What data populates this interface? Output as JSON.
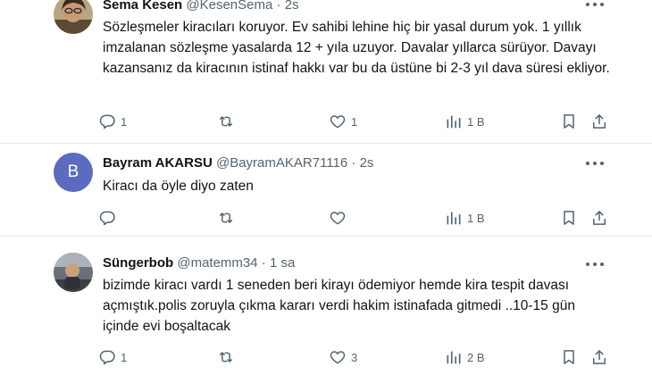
{
  "tweets": [
    {
      "name": "Sema Kesen",
      "handle": "@KesenSema",
      "sep": "·",
      "time": "2s",
      "text": "Sözleşmeler kiracıları koruyor. Ev sahibi lehine hiç bir yasal durum yok. 1 yıllık imzalanan sözleşme yasalarda 12 + yıla uzuyor. Davalar yıllarca sürüyor. Davayı kazansanız da kiracının istinaf hakkı var bu da üstüne bi 2-3 yıl dava süresi ekliyor.",
      "replies": "1",
      "reposts": "",
      "likes": "1",
      "views": "1 B"
    },
    {
      "name": "Bayram AKARSU",
      "handle": "@BayramAKAR71116",
      "sep": "·",
      "time": "2s",
      "avatar_letter": "B",
      "text": "Kiracı da öyle diyo  zaten",
      "replies": "",
      "reposts": "",
      "likes": "",
      "views": "1 B"
    },
    {
      "name": "Süngerbob",
      "handle": "@matemm34",
      "sep": "·",
      "time": "1 sa",
      "text": "bizimde kiracı vardı 1 seneden beri kirayı ödemiyor hemde kira tespit davası açmıştık.polis zoruyla çıkma kararı verdi hakim istinafada gitmedi ..10-15 gün içinde evi boşaltacak",
      "replies": "1",
      "reposts": "",
      "likes": "3",
      "views": "2 B"
    }
  ],
  "icons": {
    "reply": "reply-icon",
    "repost": "repost-icon",
    "like": "heart-icon",
    "views": "views-icon",
    "bookmark": "bookmark-icon",
    "share": "share-icon",
    "more": "more-icon"
  },
  "colors": {
    "avatar_b": "#5b6bbf",
    "text": "#0f1419",
    "secondary": "#536471",
    "divider": "#e7e9ea"
  }
}
